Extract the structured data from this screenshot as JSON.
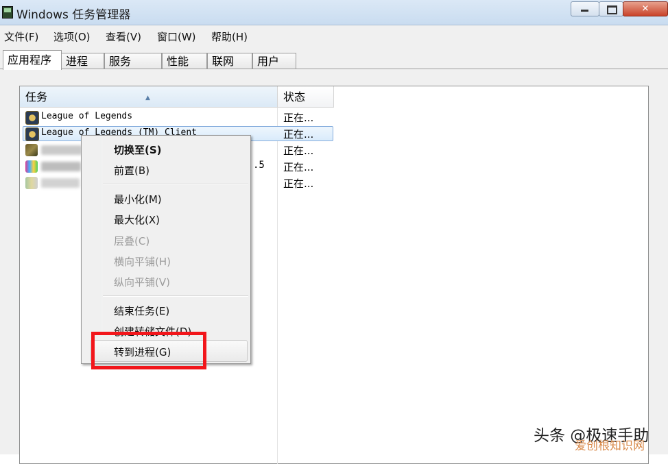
{
  "window": {
    "title": "Windows 任务管理器",
    "controls": {
      "minimize": "minimize-icon",
      "maximize": "maximize-icon",
      "close": "✕"
    }
  },
  "menubar": {
    "items": [
      "文件(F)",
      "选项(O)",
      "查看(V)",
      "窗口(W)",
      "帮助(H)"
    ]
  },
  "tabs": {
    "items": [
      "应用程序",
      "进程",
      "服务",
      "性能",
      "联网",
      "用户"
    ],
    "active": "应用程序"
  },
  "list": {
    "columns": [
      "任务",
      "状态"
    ],
    "sorted_column": "任务",
    "rows": [
      {
        "name": "League of Legends",
        "status": "正在..."
      },
      {
        "name": "League of Legends (TM) Client",
        "status": "正在...",
        "selected": true
      },
      {
        "name": "",
        "status": "正在..."
      },
      {
        "name": "",
        "fragment": ".5",
        "status": "正在..."
      },
      {
        "name": "",
        "status": "正在..."
      }
    ]
  },
  "context_menu": {
    "items": [
      {
        "label": "切换至(S)",
        "enabled": true,
        "bold": true
      },
      {
        "label": "前置(B)",
        "enabled": true
      },
      {
        "label": "最小化(M)",
        "enabled": true
      },
      {
        "label": "最大化(X)",
        "enabled": true
      },
      {
        "label": "层叠(C)",
        "enabled": false
      },
      {
        "label": "横向平铺(H)",
        "enabled": false
      },
      {
        "label": "纵向平铺(V)",
        "enabled": false
      },
      {
        "label": "结束任务(E)",
        "enabled": true
      },
      {
        "label": "创建转储文件(D)",
        "enabled": true
      },
      {
        "label": "转到进程(G)",
        "enabled": true,
        "highlighted": true
      }
    ],
    "highlight_color": "#f2161b"
  },
  "watermark": {
    "text": "头条 @极速手助",
    "text2": "爱创根知识网"
  }
}
